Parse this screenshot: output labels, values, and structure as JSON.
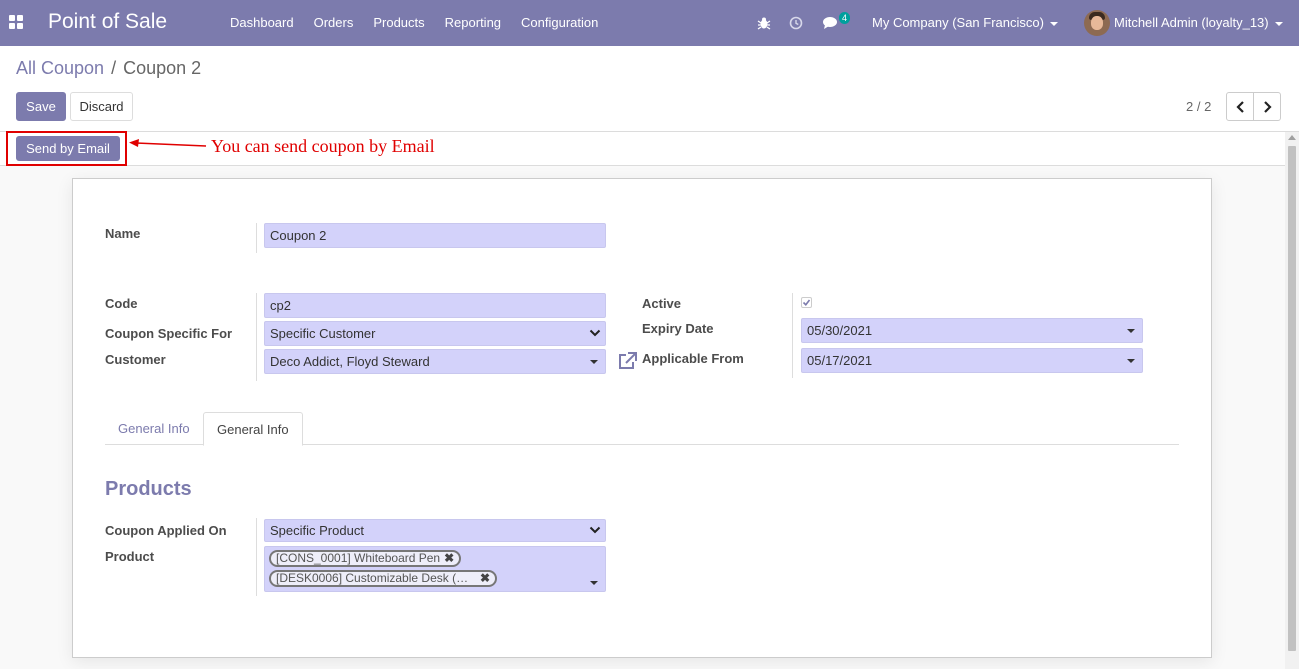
{
  "navbar": {
    "app_title": "Point of Sale",
    "menu": [
      "Dashboard",
      "Orders",
      "Products",
      "Reporting",
      "Configuration"
    ],
    "messages_count": "4",
    "company": "My Company (San Francisco)",
    "user": "Mitchell Admin (loyalty_13)"
  },
  "breadcrumb": {
    "parent": "All Coupon",
    "separator": "/",
    "current": "Coupon 2"
  },
  "actions": {
    "save_label": "Save",
    "discard_label": "Discard"
  },
  "pager": {
    "value": "2 / 2"
  },
  "header": {
    "send_email_label": "Send by Email",
    "annotation": "You can send coupon by Email"
  },
  "form": {
    "name_label": "Name",
    "name_value": "Coupon 2",
    "code_label": "Code",
    "code_value": "cp2",
    "specific_for_label": "Coupon Specific For",
    "specific_for_value": "Specific Customer",
    "customer_label": "Customer",
    "customer_value": "Deco Addict, Floyd Steward",
    "active_label": "Active",
    "active_checked": true,
    "expiry_label": "Expiry Date",
    "expiry_value": "05/30/2021",
    "applicable_label": "Applicable From",
    "applicable_value": "05/17/2021"
  },
  "tabs": [
    "General Info",
    "General Info"
  ],
  "products_section": {
    "title": "Products",
    "applied_on_label": "Coupon Applied On",
    "applied_on_value": "Specific Product",
    "product_label": "Product",
    "product_tags": [
      "[CONS_0001] Whiteboard Pen",
      "[DESK0006] Customizable Desk (…"
    ]
  },
  "colors": {
    "brand": "#7c7bad",
    "field_bg": "#d3d2fa",
    "annotation": "#e00000"
  }
}
